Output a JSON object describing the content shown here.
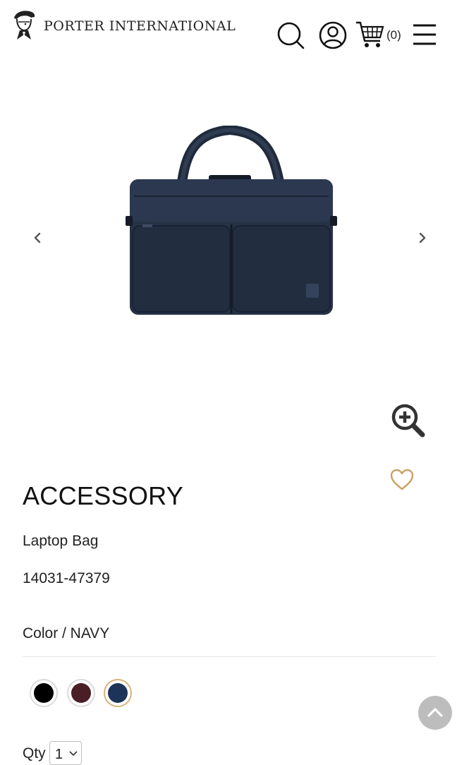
{
  "header": {
    "brand_name": "PORTER INTERNATIONAL",
    "logo_icon": "porter-logo-icon",
    "search_icon": "search-icon",
    "account_icon": "user-circle-icon",
    "cart_icon": "cart-icon",
    "cart_count": "(0)",
    "menu_icon": "hamburger-icon"
  },
  "gallery": {
    "prev_icon": "chevron-left-icon",
    "next_icon": "chevron-right-icon",
    "zoom_icon": "zoom-in-icon"
  },
  "product": {
    "category": "ACCESSORY",
    "name": "Laptop Bag",
    "code": "14031-47379",
    "color_label": "Color / NAVY",
    "wishlist_icon": "heart-icon",
    "swatches": [
      {
        "color": "#000000",
        "selected": false
      },
      {
        "color": "#4a1e27",
        "selected": false
      },
      {
        "color": "#1d3358",
        "selected": true
      }
    ],
    "qty_label": "Qty",
    "qty_value": "1"
  },
  "colors": {
    "accent_gold": "#c9a063",
    "bag_navy": "#263246",
    "back_to_top_bg": "#bdbdbd"
  },
  "back_to_top_icon": "chevron-up-icon"
}
